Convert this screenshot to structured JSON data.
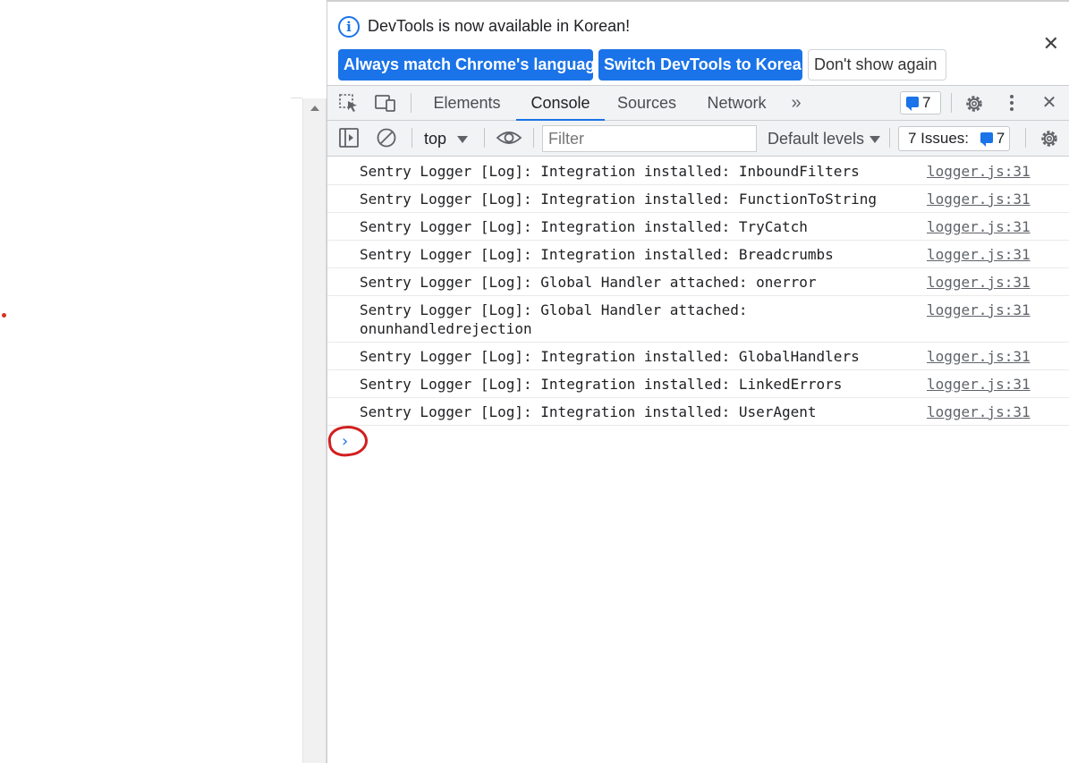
{
  "infobar": {
    "message": "DevTools is now available in Korean!",
    "buttons": {
      "always_match": "Always match Chrome's language",
      "switch": "Switch DevTools to Korean",
      "dont_show": "Don't show again"
    },
    "close_icon": "close-icon"
  },
  "tabs": {
    "elements": "Elements",
    "console": "Console",
    "sources": "Sources",
    "network": "Network",
    "active": "Console"
  },
  "toolbar": {
    "messages_count": "7",
    "context": "top",
    "filter_placeholder": "Filter",
    "levels": "Default levels",
    "issues_label": "7 Issues:",
    "issues_count": "7"
  },
  "console": {
    "messages": [
      {
        "text": "Sentry Logger [Log]: Integration installed: InboundFilters",
        "source": "logger.js:31"
      },
      {
        "text": "Sentry Logger [Log]: Integration installed: FunctionToString",
        "source": "logger.js:31"
      },
      {
        "text": "Sentry Logger [Log]: Integration installed: TryCatch",
        "source": "logger.js:31"
      },
      {
        "text": "Sentry Logger [Log]: Integration installed: Breadcrumbs",
        "source": "logger.js:31"
      },
      {
        "text": "Sentry Logger [Log]: Global Handler attached: onerror",
        "source": "logger.js:31"
      },
      {
        "text": "Sentry Logger [Log]: Global Handler attached:\nonunhandledrejection",
        "source": "logger.js:31"
      },
      {
        "text": "Sentry Logger [Log]: Integration installed: GlobalHandlers",
        "source": "logger.js:31"
      },
      {
        "text": "Sentry Logger [Log]: Integration installed: LinkedErrors",
        "source": "logger.js:31"
      },
      {
        "text": "Sentry Logger [Log]: Integration installed: UserAgent",
        "source": "logger.js:31"
      }
    ],
    "prompt_glyph": "›"
  },
  "colors": {
    "accent": "#1a73e8",
    "annotation": "#d21f1f",
    "toolbar_bg": "#f1f3f4"
  }
}
